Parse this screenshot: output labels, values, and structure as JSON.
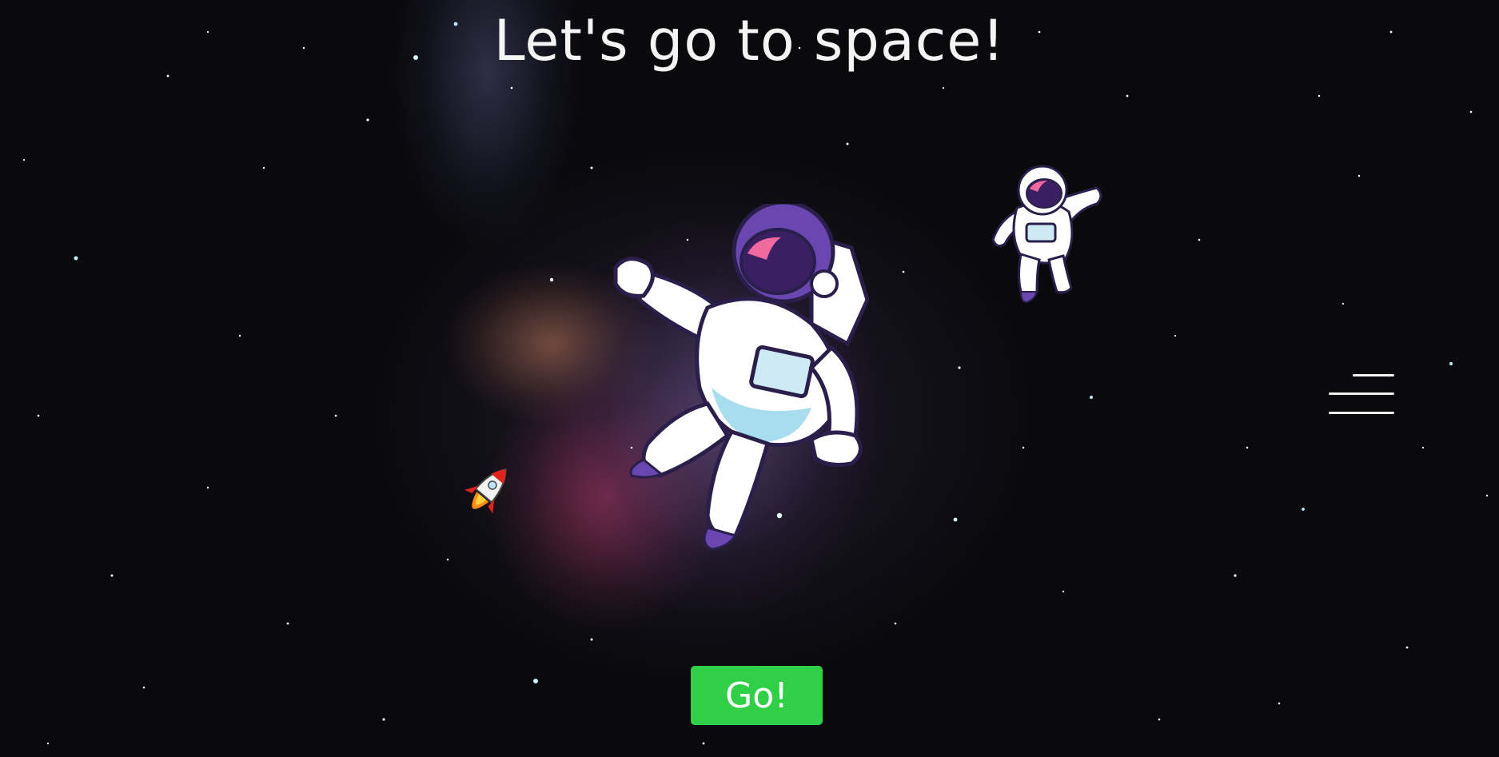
{
  "page": {
    "title": "Let's go to space!"
  },
  "actions": {
    "go_label": "Go!"
  },
  "icons": {
    "menu": "hamburger-menu-icon",
    "astronaut_large": "astronaut-illustration",
    "astronaut_small": "astronaut-illustration",
    "rocket": "rocket-icon"
  },
  "colors": {
    "go_button": "#2fcf48",
    "title_text": "#f4f4f4",
    "helmet_visor": "#3a1f63",
    "helmet_shell": "#6a47b0",
    "suit": "#ffffff",
    "suit_shadow": "#a8dcef"
  }
}
